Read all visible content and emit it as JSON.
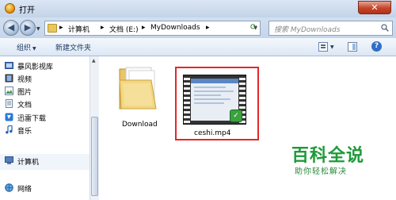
{
  "window": {
    "title": "打开",
    "close_label": "✕"
  },
  "nav": {
    "back_icon": "back-arrow-icon",
    "forward_icon": "forward-arrow-icon",
    "breadcrumbs": [
      "计算机",
      "文档 (E:)",
      "MyDownloads"
    ],
    "search_placeholder": "搜索 MyDownloads"
  },
  "toolbar": {
    "organize": "组织",
    "new_folder": "新建文件夹"
  },
  "sidebar": {
    "items": [
      {
        "label": "暴风影视库",
        "icon": "media-library-icon"
      },
      {
        "label": "视频",
        "icon": "video-icon"
      },
      {
        "label": "图片",
        "icon": "picture-icon"
      },
      {
        "label": "文档",
        "icon": "document-icon"
      },
      {
        "label": "迅雷下载",
        "icon": "thunder-download-icon"
      },
      {
        "label": "音乐",
        "icon": "music-icon"
      },
      {
        "label": "计算机",
        "icon": "computer-icon"
      },
      {
        "label": "网络",
        "icon": "network-icon"
      }
    ]
  },
  "files": [
    {
      "name": "Download",
      "icon": "folder-icon"
    },
    {
      "name": "ceshi.mp4",
      "icon": "video-file-icon"
    }
  ],
  "watermark": {
    "title": "百科全说",
    "subtitle": "助你轻松解决"
  },
  "colors": {
    "highlight_border": "#e32727",
    "watermark": "#1e9a38"
  }
}
